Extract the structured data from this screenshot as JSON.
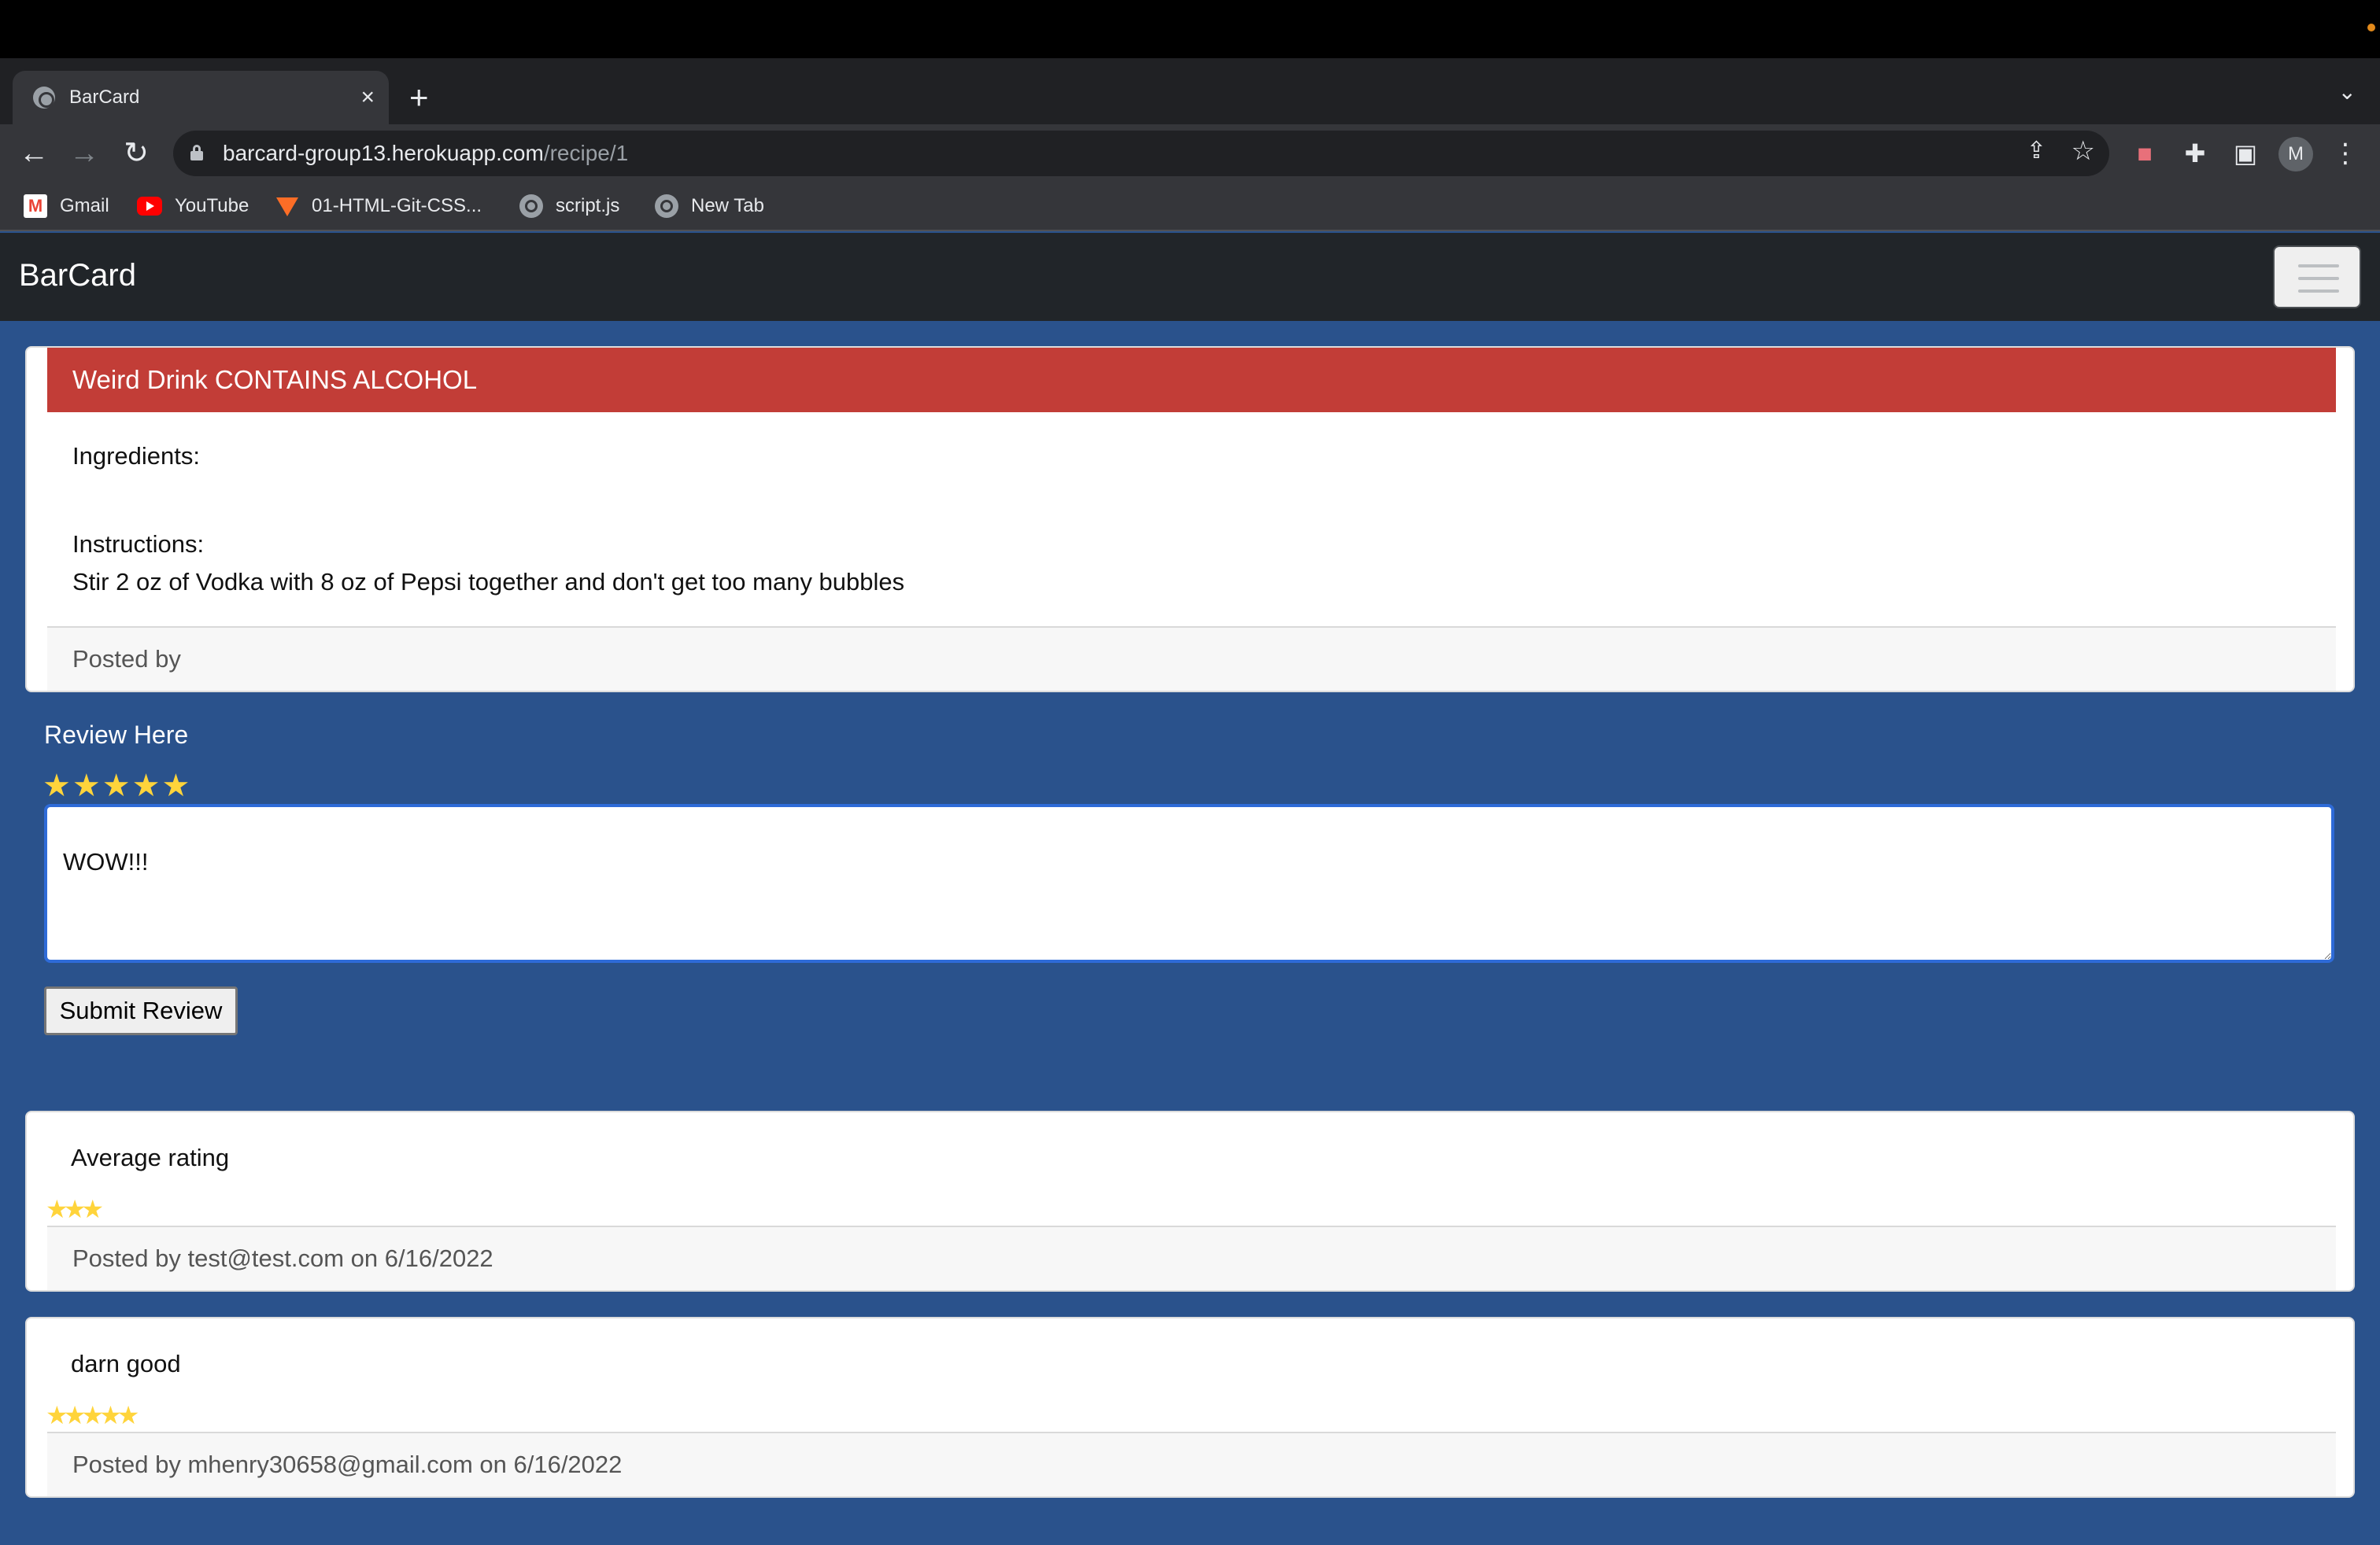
{
  "browser": {
    "tab_title": "BarCard",
    "tab_close": "×",
    "new_tab": "+",
    "tab_dropdown": "⌄",
    "url_host": "barcard-group13.herokuapp.com",
    "url_path": "/recipe/1",
    "avatar_initial": "M",
    "bookmarks": [
      {
        "label": "Gmail",
        "icon": "gmail-icon"
      },
      {
        "label": "YouTube",
        "icon": "youtube-icon"
      },
      {
        "label": "01-HTML-Git-CSS...",
        "icon": "gitlab-icon"
      },
      {
        "label": "script.js",
        "icon": "globe-icon"
      },
      {
        "label": "New Tab",
        "icon": "globe-icon"
      }
    ]
  },
  "navbar": {
    "brand": "BarCard"
  },
  "recipe": {
    "title": "Weird Drink CONTAINS ALCOHOL",
    "ingredients_label": "Ingredients:",
    "instructions_label": "Instructions:",
    "instructions": "Stir 2 oz of Vodka with 8 oz of Pepsi together and don't get too many bubbles",
    "posted_by": "Posted by"
  },
  "review_form": {
    "label": "Review Here",
    "rating": 5,
    "stars": "★★★★★",
    "text": "WOW!!!",
    "submit_label": "Submit Review"
  },
  "reviews": [
    {
      "text": "Average rating",
      "rating": 3,
      "stars": "★★★",
      "posted": "Posted by test@test.com on 6/16/2022"
    },
    {
      "text": "darn good",
      "rating": 5,
      "stars": "★★★★★",
      "posted": "Posted by mhenry30658@gmail.com on 6/16/2022"
    }
  ],
  "colors": {
    "page_bg": "#2a528c",
    "navbar_bg": "#212529",
    "recipe_header": "#c23d37",
    "star": "#ffd43b"
  }
}
